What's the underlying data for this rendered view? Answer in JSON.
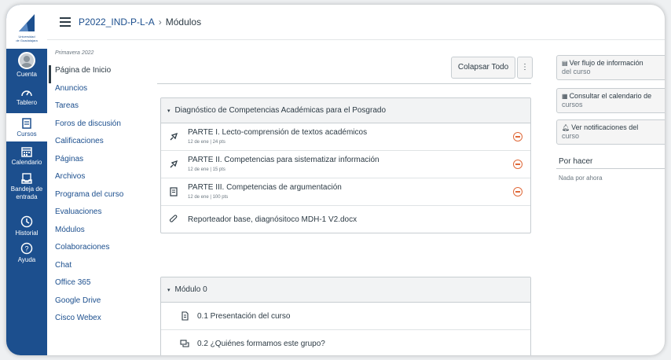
{
  "logo": {
    "line1": "Universidad",
    "line2": "de Guadalajara"
  },
  "global_nav": [
    {
      "label": "Cuenta",
      "icon": "avatar"
    },
    {
      "label": "Tablero",
      "icon": "dashboard-icon"
    },
    {
      "label": "Cursos",
      "icon": "book-icon"
    },
    {
      "label": "Calendario",
      "icon": "calendar-icon"
    },
    {
      "label": "Bandeja de entrada",
      "icon": "inbox-icon"
    },
    {
      "label": "Historial",
      "icon": "clock-icon"
    },
    {
      "label": "Ayuda",
      "icon": "help-icon"
    }
  ],
  "breadcrumb": {
    "course": "P2022_IND-P-L-A",
    "separator": "›",
    "page": "Módulos"
  },
  "course_nav": {
    "term": "Primavera 2022",
    "items": [
      "Página de Inicio",
      "Anuncios",
      "Tareas",
      "Foros de discusión",
      "Calificaciones",
      "Páginas",
      "Archivos",
      "Programa del curso",
      "Evaluaciones",
      "Módulos",
      "Colaboraciones",
      "Chat",
      "Office 365",
      "Google Drive",
      "Cisco Webex"
    ]
  },
  "toolbar": {
    "collapse_label": "Colapsar Todo",
    "more_label": "⋮"
  },
  "modules": [
    {
      "title": "Diagnóstico de Competencias Académicas para el Posgrado",
      "items": [
        {
          "title": "PARTE I. Lecto-comprensión de textos académicos",
          "meta": "12 de ene | 24 pts",
          "icon": "quiz-icon"
        },
        {
          "title": "PARTE II. Competencias para sistematizar información",
          "meta": "12 de ene | 15 pts",
          "icon": "quiz-icon"
        },
        {
          "title": "PARTE III. Competencias de argumentación",
          "meta": "12 de ene | 100 pts",
          "icon": "assignment-icon"
        },
        {
          "title": "Reporteador base, diagnósitoco MDH-1 V2.docx",
          "meta": "",
          "icon": "attachment-icon"
        }
      ]
    },
    {
      "title": "Módulo 0",
      "items": [
        {
          "title": "0.1 Presentación del curso",
          "icon": "page-icon"
        },
        {
          "title": "0.2 ¿Quiénes formamos este grupo?",
          "icon": "discussion-icon"
        }
      ]
    }
  ],
  "sidebar": {
    "buttons": [
      {
        "line1": "Ver flujo de información",
        "line2": "del curso",
        "icon": "stream-icon"
      },
      {
        "line1": "Consultar el calendario de",
        "line2": "cursos",
        "icon": "calendar-icon"
      },
      {
        "line1": "Ver notificaciones del",
        "line2": "curso",
        "icon": "bell-icon"
      }
    ],
    "todo_title": "Por hacer",
    "todo_empty": "Nada por ahora"
  },
  "colors": {
    "brand": "#1c4f8e",
    "status": "#e06a3a"
  }
}
